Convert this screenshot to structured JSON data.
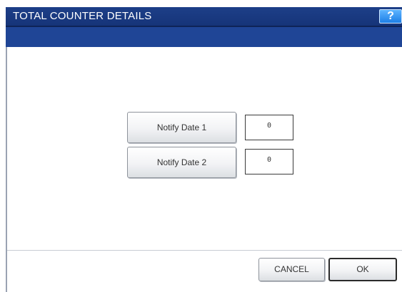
{
  "window": {
    "title": "TOTAL COUNTER DETAILS",
    "help_label": "?"
  },
  "notify_dates": [
    {
      "label": "Notify Date 1",
      "value": "0"
    },
    {
      "label": "Notify Date 2",
      "value": "0"
    }
  ],
  "footer": {
    "cancel_label": "CANCEL",
    "ok_label": "OK"
  },
  "colors": {
    "title_bar": "#1d3f88",
    "band": "#1f4596",
    "help_button": "#1d7fe6"
  }
}
